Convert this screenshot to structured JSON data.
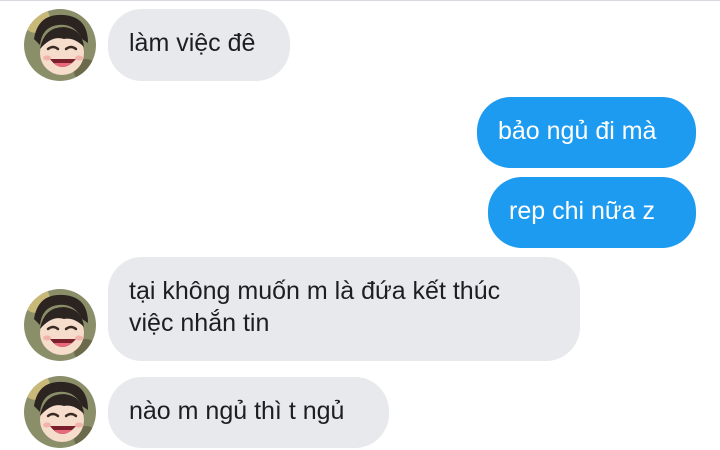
{
  "conversation": {
    "messages": [
      {
        "direction": "incoming",
        "lines": [
          "làm việc đê"
        ],
        "avatar": "cartoon-avatar-icon"
      },
      {
        "direction": "outgoing",
        "lines": [
          "bảo ngủ đi mà"
        ]
      },
      {
        "direction": "outgoing",
        "lines": [
          "rep chi nữa z"
        ]
      },
      {
        "direction": "incoming",
        "lines": [
          "tại không muốn m là đứa kết thúc",
          "việc nhắn tin"
        ],
        "avatar": "cartoon-avatar-icon"
      },
      {
        "direction": "incoming",
        "lines": [
          "nào m ngủ thì t ngủ"
        ],
        "avatar": "cartoon-avatar-icon"
      }
    ]
  },
  "colors": {
    "incoming_bubble": "#e7e9ed",
    "outgoing_bubble": "#1d9bf0",
    "incoming_text": "#1c1e21",
    "outgoing_text": "#ffffff"
  }
}
